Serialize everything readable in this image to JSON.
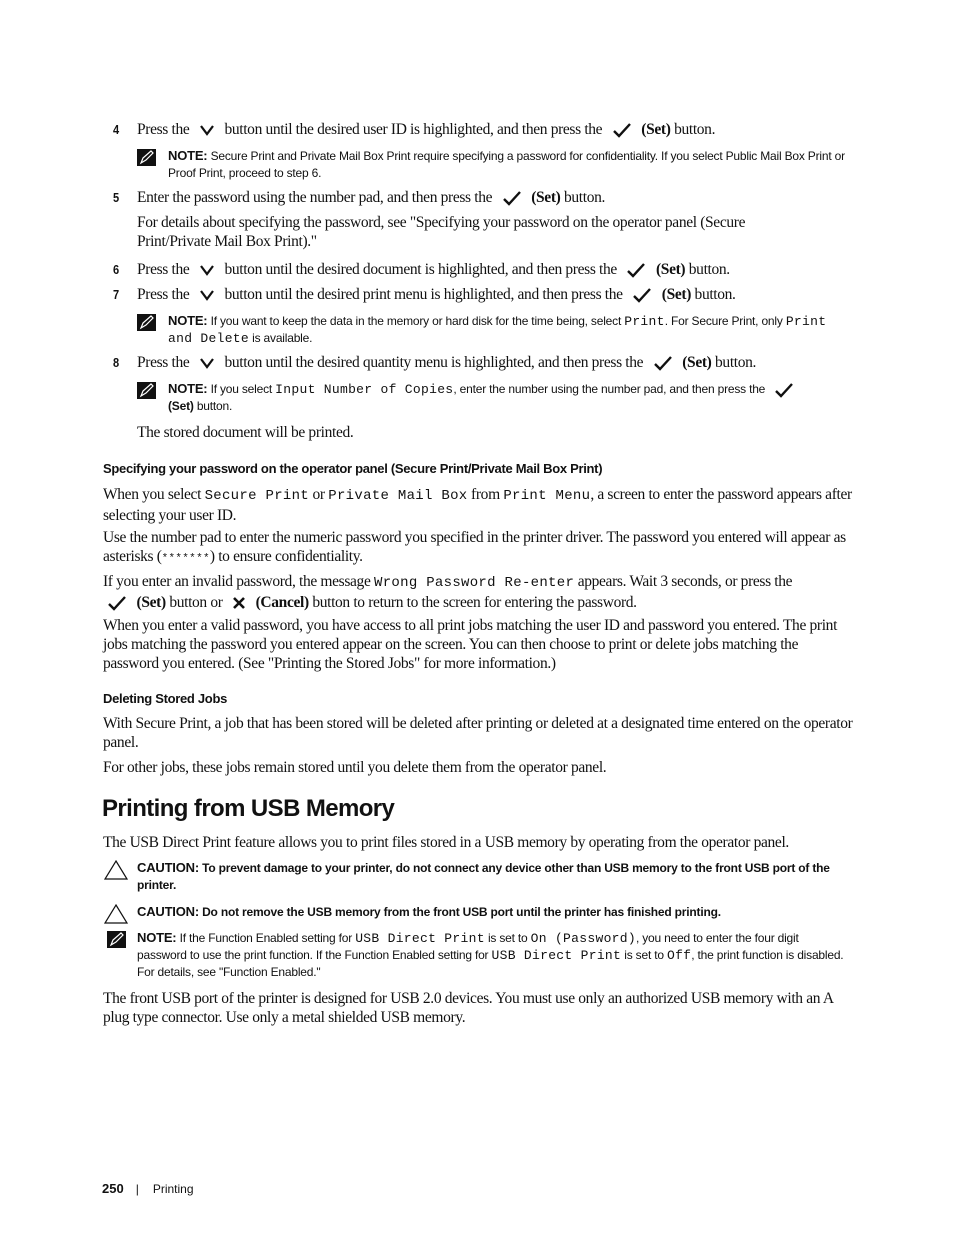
{
  "steps": [
    {
      "num": "4",
      "pre": "Press the",
      "mid": "button until the desired user ID is highlighted, and then press the",
      "set": "(Set)",
      "post": "button."
    },
    {
      "num": "5",
      "pre": "Enter the password using the number pad, and then press the",
      "set": "(Set)",
      "post": "button."
    },
    {
      "num": "6",
      "pre": "Press the",
      "mid": "button until the desired document is highlighted, and then press the",
      "set": "(Set)",
      "post": "button."
    },
    {
      "num": "7",
      "pre": "Press the",
      "mid": "button until the desired print menu is highlighted, and then press the",
      "set": "(Set)",
      "post": "button."
    },
    {
      "num": "8",
      "pre": "Press the",
      "mid": "button until the desired quantity menu is highlighted, and then press the",
      "set": "(Set)",
      "post": "button."
    }
  ],
  "step5_detail": "For details about specifying the password, see \"Specifying your password on the operator panel (Secure Print/Private Mail Box Print).\"",
  "notes": {
    "label": "NOTE:",
    "n1": "Secure Print and Private Mail Box Print require specifying a password for confidentiality. If you select Public Mail Box Print or Proof Print, proceed to step 6.",
    "n2_a": "If you want to keep the data in the memory or hard disk for the time being, select",
    "n2_code1": "Print",
    "n2_b": ". For Secure Print, only",
    "n2_code2": "Print and Delete",
    "n2_c": "is available.",
    "n3_a": "If you select",
    "n3_code": "Input Number of Copies",
    "n3_b": ", enter the number using the number pad, and then press the",
    "n3_set": "(Set)",
    "n3_c": "button.",
    "n4_a": "If the Function Enabled setting for",
    "n4_code1": "USB Direct Print",
    "n4_b": "is set to",
    "n4_code2": "On (Password)",
    "n4_c": ", you need to enter the four digit password to use the print function. If the Function Enabled setting for",
    "n4_code3": "USB Direct Print",
    "n4_d": "is set to",
    "n4_code4": "Off",
    "n4_e": ", the print function is disabled. For details, see \"Function Enabled.\""
  },
  "stored_printed": "The stored document will be printed.",
  "section_password": {
    "heading": "Specifying your password on the operator panel (Secure Print/Private Mail Box Print)",
    "p1_a": "When you select",
    "p1_code1": "Secure Print",
    "p1_b": "or",
    "p1_code2": "Private Mail Box",
    "p1_c": "from",
    "p1_code3": "Print Menu",
    "p1_d": ", a screen to enter the password appears after selecting your user ID.",
    "p2_a": "Use the number pad to enter the numeric password you specified in the printer driver. The password you entered will appear as asterisks (",
    "p2_code": "*******",
    "p2_b": ") to ensure confidentiality.",
    "p3_a": "If you enter an invalid password, the message",
    "p3_code": "Wrong Password Re-enter",
    "p3_b": "appears. Wait 3 seconds, or press the",
    "p3_set": "(Set)",
    "p3_c": "button or",
    "p3_cancel": "(Cancel)",
    "p3_d": "button to return to the screen for entering the password.",
    "p4": "When you enter a valid password, you have access to all print jobs matching the user ID and password you entered. The print jobs matching the password you entered appear on the screen. You can then choose to print or delete jobs matching the password you entered. (See \"Printing the Stored Jobs\" for more information.)"
  },
  "section_deleting": {
    "heading": "Deleting Stored Jobs",
    "p1": "With Secure Print, a job that has been stored will be deleted after printing or deleted at a designated time entered on the operator panel.",
    "p2": "For other jobs, these jobs remain stored until you delete them from the operator panel."
  },
  "section_usb": {
    "title": "Printing from USB Memory",
    "intro": "The USB Direct Print feature allows you to print files stored in a USB memory by operating from the operator panel.",
    "caution_label": "CAUTION:",
    "caution1": "To prevent damage to your printer, do not connect any device other than USB memory to the front USB port of the printer.",
    "caution2": "Do not remove the USB memory from the front USB port until the printer has finished printing.",
    "closing": "The front USB port of the printer is designed for USB 2.0 devices. You must use only an authorized USB memory with an A plug type connector. Use only a metal shielded USB memory."
  },
  "footer": {
    "page_number": "250",
    "separator": "|",
    "chapter": "Printing"
  }
}
